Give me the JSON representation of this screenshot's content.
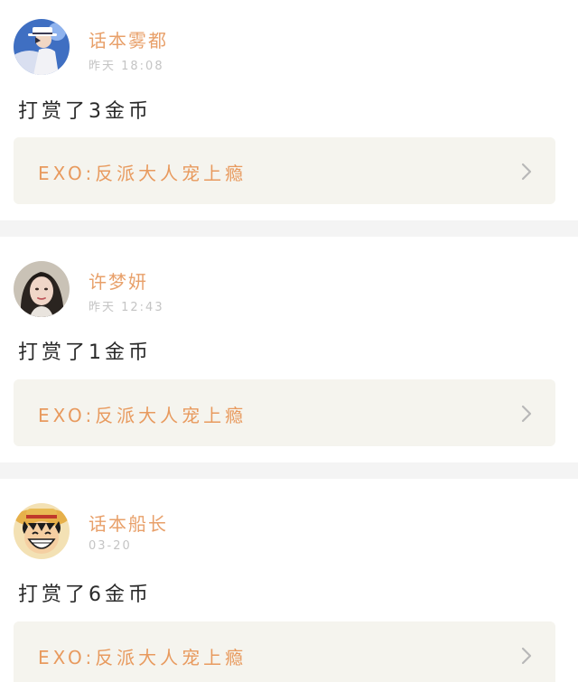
{
  "feed": {
    "items": [
      {
        "username": "话本雾都",
        "time": "昨天 18:08",
        "reward": "打赏了3金币",
        "book_title": "EXO:反派大人宠上瘾",
        "avatar_icon": "avatar-white-hat-magician-icon"
      },
      {
        "username": "许梦妍",
        "time": "昨天 12:43",
        "reward": "打赏了1金币",
        "book_title": "EXO:反派大人宠上瘾",
        "avatar_icon": "avatar-woman-portrait-icon"
      },
      {
        "username": "话本船长",
        "time": "03-20",
        "reward": "打赏了6金币",
        "book_title": "EXO:反派大人宠上瘾",
        "avatar_icon": "avatar-straw-hat-boy-icon"
      }
    ]
  },
  "colors": {
    "username": "#e8a06a",
    "book_title": "#e89a5e",
    "link_background": "#f5f4ee",
    "separator": "#f4f4f4",
    "timestamp": "#c4c4c4",
    "reward_text": "#2a2a2a",
    "chevron": "#b8b8b8"
  }
}
